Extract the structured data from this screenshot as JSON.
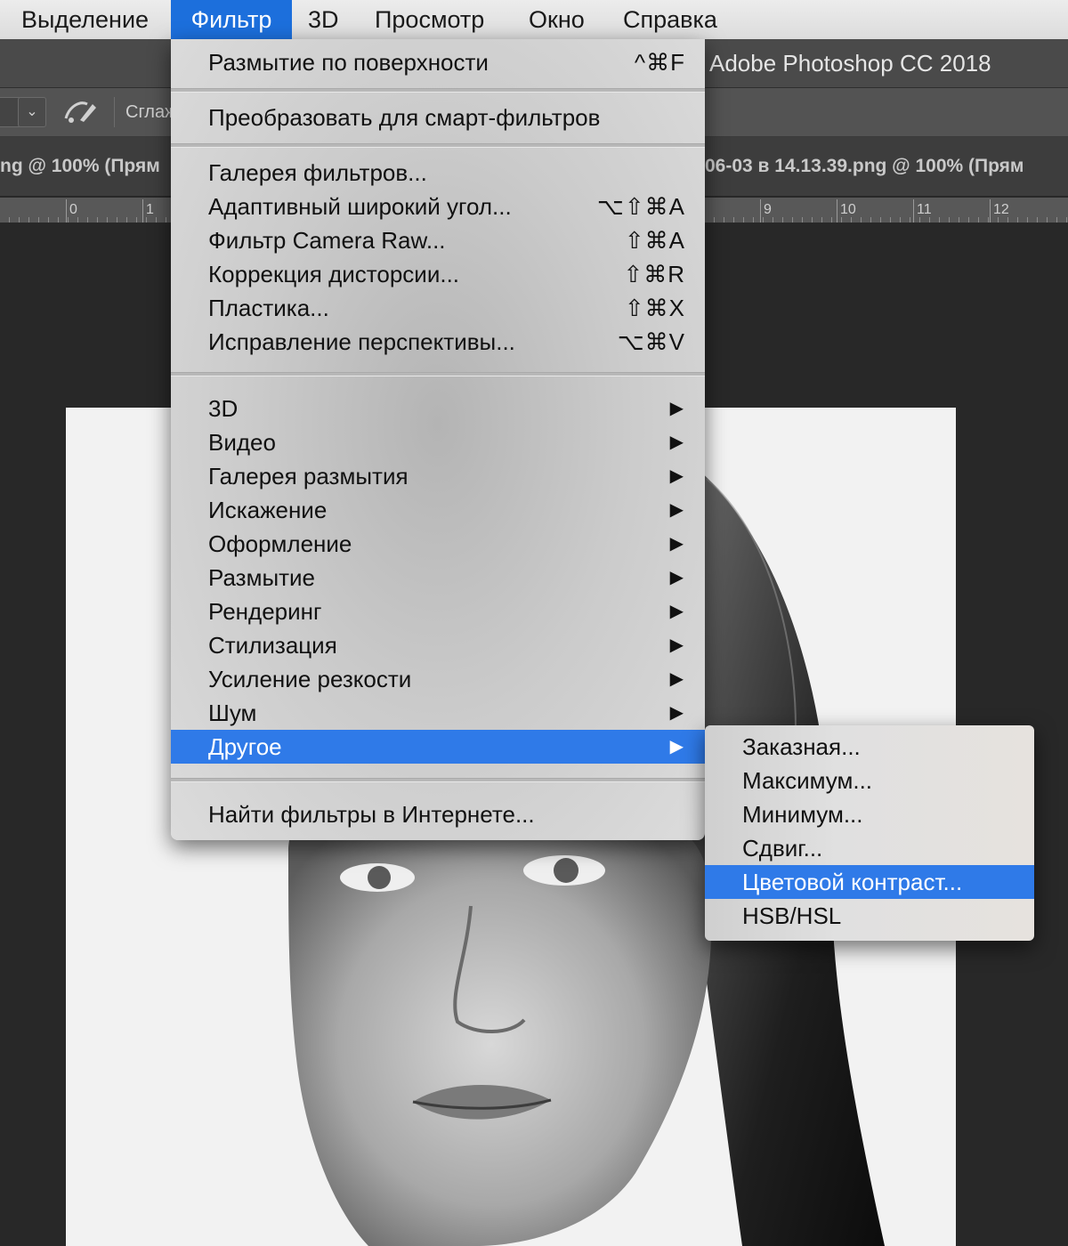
{
  "menubar": {
    "items": [
      "Выделение",
      "Фильтр",
      "3D",
      "Просмотр",
      "Окно",
      "Справка"
    ],
    "active_index": 1
  },
  "app": {
    "title": "Adobe Photoshop CC 2018"
  },
  "options_bar": {
    "smoothing_label": "Сглаж"
  },
  "tabs": {
    "left_tab": "ng @ 100% (Прям",
    "right_tab": "06-03 в 14.13.39.png @ 100% (Прям"
  },
  "ruler": {
    "labels": [
      "0",
      "1",
      "9",
      "10",
      "11",
      "12"
    ]
  },
  "filter_menu": {
    "last_filter": {
      "label": "Размытие по поверхности",
      "shortcut": "^⌘F"
    },
    "convert_smart": "Преобразовать для смарт-фильтров",
    "special_filters": [
      {
        "label": "Галерея фильтров...",
        "shortcut": ""
      },
      {
        "label": "Адаптивный широкий угол...",
        "shortcut": "⌥⇧⌘A"
      },
      {
        "label": "Фильтр Camera Raw...",
        "shortcut": "⇧⌘A"
      },
      {
        "label": "Коррекция дисторсии...",
        "shortcut": "⇧⌘R"
      },
      {
        "label": "Пластика...",
        "shortcut": "⇧⌘X"
      },
      {
        "label": "Исправление перспективы...",
        "shortcut": "⌥⌘V"
      }
    ],
    "submenus": [
      {
        "label": "3D"
      },
      {
        "label": "Видео"
      },
      {
        "label": "Галерея размытия"
      },
      {
        "label": "Искажение"
      },
      {
        "label": "Оформление"
      },
      {
        "label": "Размытие"
      },
      {
        "label": "Рендеринг"
      },
      {
        "label": "Стилизация"
      },
      {
        "label": "Усиление резкости"
      },
      {
        "label": "Шум"
      },
      {
        "label": "Другое"
      }
    ],
    "highlighted_submenu": "Другое",
    "browse_online": "Найти фильтры в Интернете...",
    "submenu_arrow": "▶"
  },
  "other_submenu": {
    "items": [
      "Заказная...",
      "Максимум...",
      "Минимум...",
      "Сдвиг...",
      "Цветовой контраст...",
      "HSB/HSL"
    ],
    "highlighted_index": 4
  },
  "colors": {
    "menu_highlight": "#2f7ae8",
    "menubar_active": "#1c6fdc"
  }
}
